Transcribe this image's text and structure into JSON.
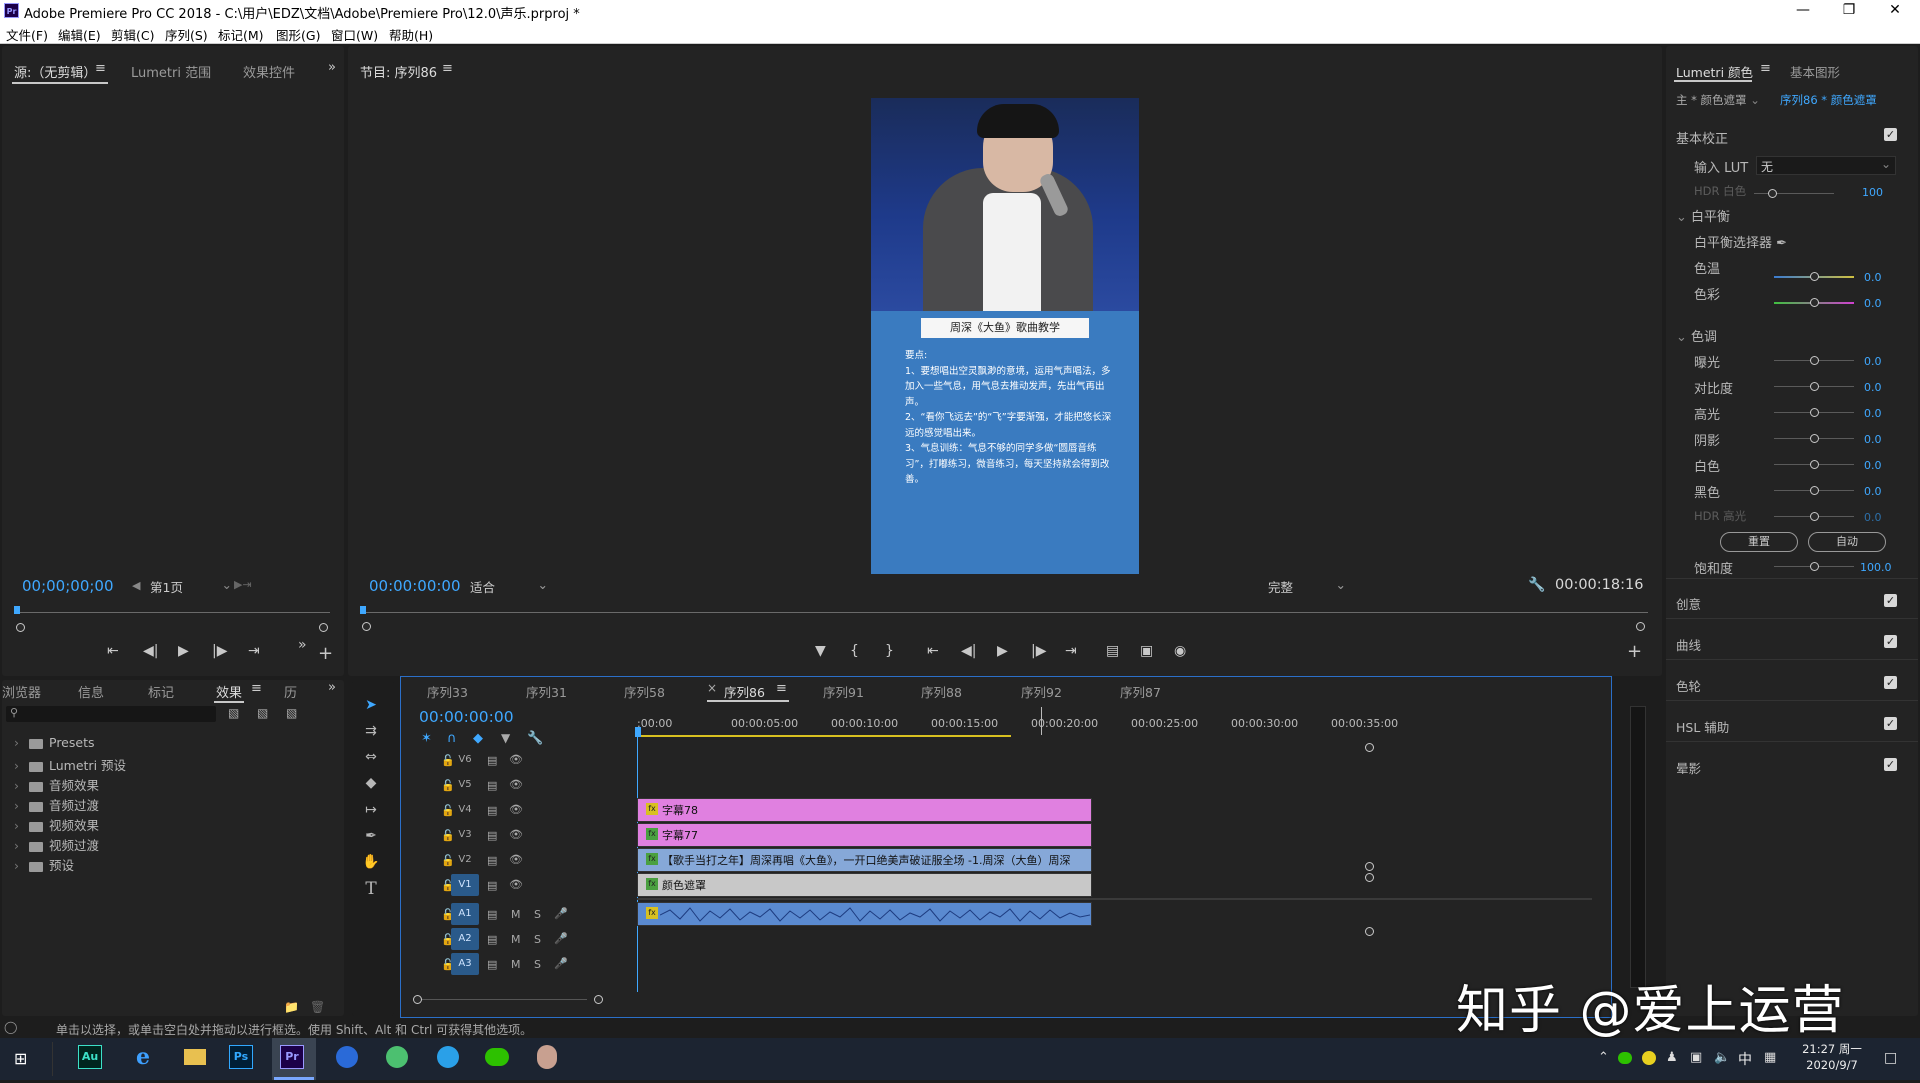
{
  "window": {
    "title": "Adobe Premiere Pro CC 2018 - C:\\用户\\EDZ\\文档\\Adobe\\Premiere Pro\\12.0\\声乐.prproj *",
    "app_icon": "Pr",
    "controls": [
      "minimize-icon",
      "maximize-icon",
      "close-icon"
    ]
  },
  "menu": [
    "文件(F)",
    "编辑(E)",
    "剪辑(C)",
    "序列(S)",
    "标记(M)",
    "图形(G)",
    "窗口(W)",
    "帮助(H)"
  ],
  "source_panel": {
    "tabs": [
      "源:（无剪辑）",
      "Lumetri 范围",
      "效果控件"
    ],
    "timecode": "00;00;00;00",
    "page_select": "第1页"
  },
  "program_panel": {
    "title": "节目: 序列86",
    "timecode": "00:00:00:00",
    "fit": "适合",
    "quality": "完整",
    "duration": "00:00:18:16",
    "preview": {
      "caption_title": "周深《大鱼》歌曲教学",
      "heading": "要点:",
      "lines": [
        "1、要想唱出空灵飘渺的意境，运用气声唱法，多加入一些气息，用气息去推动发声，先出气再出声。",
        "2、“看你飞远去”的“飞”字要渐强，才能把悠长深远的感觉唱出来。",
        "3、气息训练：气息不够的同学多做“圆唇音练习”，打嘟练习，微音练习，每天坚持就会得到改善。"
      ]
    }
  },
  "project_panel": {
    "tabs": [
      "浏览器",
      "信息",
      "标记",
      "效果",
      "历"
    ],
    "search_placeholder": "",
    "items": [
      "Presets",
      "Lumetri 预设",
      "音频效果",
      "音频过渡",
      "视频效果",
      "视频过渡",
      "预设"
    ]
  },
  "timeline": {
    "tabs": [
      "序列33",
      "序列31",
      "序列58",
      "序列86",
      "序列91",
      "序列88",
      "序列92",
      "序列87"
    ],
    "active_tab": "序列86",
    "timecode": "00:00:00:00",
    "ruler": [
      ":00:00",
      "00:00:05:00",
      "00:00:10:00",
      "00:00:15:00",
      "00:00:20:00",
      "00:00:25:00",
      "00:00:30:00",
      "00:00:35:00"
    ],
    "video_tracks": [
      "V6",
      "V5",
      "V4",
      "V3",
      "V2",
      "V1"
    ],
    "audio_tracks": [
      "A1",
      "A2",
      "A3"
    ],
    "clips": [
      {
        "track": "V4",
        "label": "字幕78",
        "color": "#e080e0"
      },
      {
        "track": "V3",
        "label": "字幕77",
        "color": "#e080e0"
      },
      {
        "track": "V2",
        "label": "【歌手当打之年】周深再唱《大鱼》，一开口绝美声破证服全场 -1.周深（大鱼）周深",
        "color": "#86a8d8"
      },
      {
        "track": "V1",
        "label": "颜色遮罩",
        "color": "#c8c8c8"
      },
      {
        "track": "A1",
        "label": "",
        "color": "#5a8ad0"
      }
    ],
    "track_btns": {
      "mute": "M",
      "solo": "S"
    }
  },
  "lumetri": {
    "tabs": [
      "Lumetri 颜色",
      "基本图形"
    ],
    "master": "主 * 颜色遮罩",
    "sequence": "序列86 * 颜色遮罩",
    "basic_correction": "基本校正",
    "input_lut_label": "输入 LUT",
    "input_lut_value": "无",
    "hdr_white": {
      "label": "HDR 白色",
      "value": "100"
    },
    "white_balance": "白平衡",
    "wb_selector": "白平衡选择器",
    "temp": {
      "label": "色温",
      "value": "0.0"
    },
    "tint": {
      "label": "色彩",
      "value": "0.0"
    },
    "tone": "色调",
    "tone_rows": [
      {
        "label": "曝光",
        "value": "0.0"
      },
      {
        "label": "对比度",
        "value": "0.0"
      },
      {
        "label": "高光",
        "value": "0.0"
      },
      {
        "label": "阴影",
        "value": "0.0"
      },
      {
        "label": "白色",
        "value": "0.0"
      },
      {
        "label": "黑色",
        "value": "0.0"
      },
      {
        "label": "HDR 高光",
        "value": "0.0"
      }
    ],
    "reset_btn": "重置",
    "auto_btn": "自动",
    "saturation": {
      "label": "饱和度",
      "value": "100.0"
    },
    "sections": [
      "创意",
      "曲线",
      "色轮",
      "HSL 辅助",
      "晕影"
    ]
  },
  "status_bar": "单击以选择，或单击空白处并拖动以进行框选。使用 Shift、Alt 和 Ctrl 可获得其他选项。",
  "watermark": "知乎 @爱上运营",
  "taskbar": {
    "apps": [
      "Au",
      "e",
      "folder",
      "Ps",
      "Pr",
      "S",
      "qq-browser",
      "edge",
      "wechat",
      "user"
    ],
    "ime": "中",
    "time": "21:27 周一",
    "date": "2020/9/7"
  },
  "colors": {
    "accent": "#3fa8ff",
    "panel": "#232323",
    "bg": "#1d1d1d",
    "title_blue": "#3a7bc0"
  }
}
